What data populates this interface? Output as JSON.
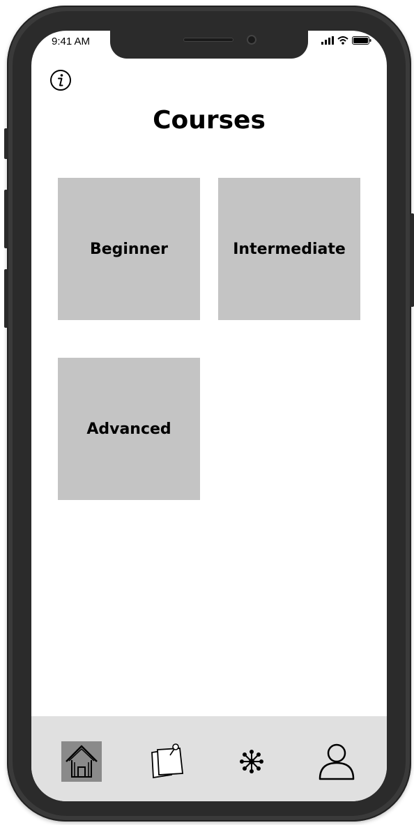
{
  "status_bar": {
    "time": "9:41 AM"
  },
  "header": {
    "title": "Courses",
    "info_icon": "info-icon"
  },
  "courses": [
    {
      "label": "Beginner"
    },
    {
      "label": "Intermediate"
    },
    {
      "label": "Advanced"
    }
  ],
  "tab_bar": {
    "active": "home",
    "tabs": [
      {
        "id": "home",
        "icon": "home-icon"
      },
      {
        "id": "notes",
        "icon": "notes-icon"
      },
      {
        "id": "network",
        "icon": "network-icon"
      },
      {
        "id": "profile",
        "icon": "profile-icon"
      }
    ]
  },
  "colors": {
    "tile": "#c4c4c4",
    "tab_bar": "#e0e0e0",
    "active_tab": "#8a8a8a",
    "frame": "#3a3a3a"
  }
}
